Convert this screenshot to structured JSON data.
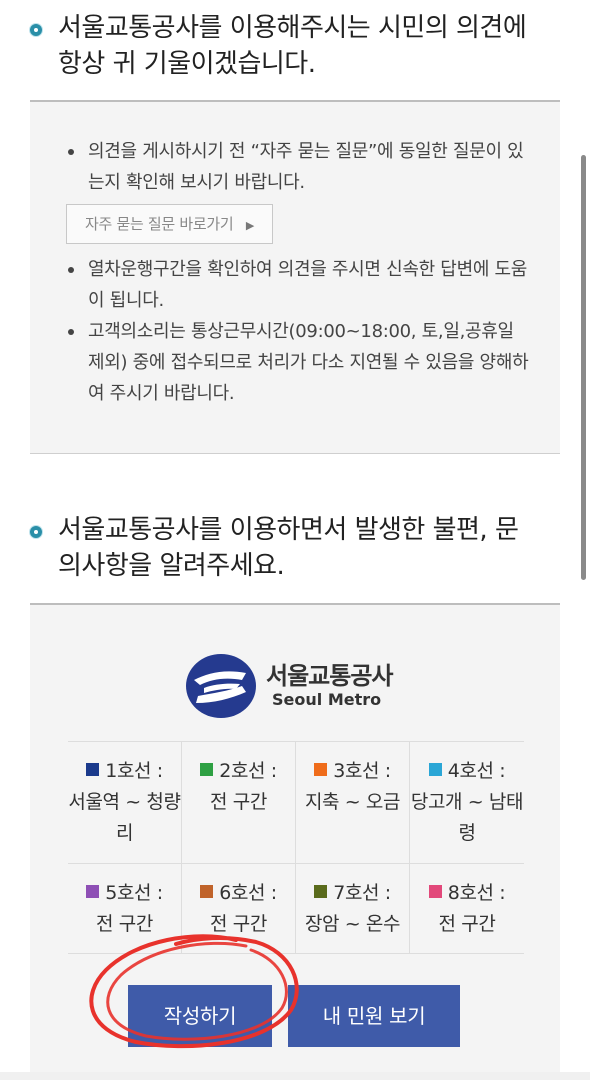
{
  "section1": {
    "title_line1": "서울교통공사를 이용해주시는 시민의 의견에",
    "title_line2": "항상 귀 기울이겠습니다."
  },
  "notices": {
    "item1": "의견을 게시하시기 전 “자주 묻는 질문”에 동일한 질문이 있는지 확인해 보시기 바랍니다.",
    "faq_button": "자주 묻는 질문 바로가기",
    "faq_arrow": "▶",
    "item2": "열차운행구간을 확인하여 의견을 주시면 신속한 답변에 도움이 됩니다.",
    "item3": "고객의소리는 통상근무시간(09:00~18:00, 토,일,공휴일 제외) 중에 접수되므로 처리가 다소 지연될 수 있음을 양해하여 주시기 바랍니다."
  },
  "section2": {
    "title_line1": "서울교통공사를 이용하면서 발생한 불편, 문",
    "title_line2": "의사항을 알려주세요."
  },
  "logo": {
    "name_ko": "서울교통공사",
    "name_en": "Seoul Metro"
  },
  "lines": [
    {
      "label": "1호선 :",
      "route": "서울역 ~ 청량리",
      "color": "#1b3a8c"
    },
    {
      "label": "2호선 :",
      "route": "전 구간",
      "color": "#2ea043"
    },
    {
      "label": "3호선 :",
      "route": "지축 ~ 오금",
      "color": "#ef6c1a"
    },
    {
      "label": "4호선 :",
      "route": "당고개 ~ 남태령",
      "color": "#2aa6d6"
    },
    {
      "label": "5호선 :",
      "route": "전 구간",
      "color": "#8e4fb5"
    },
    {
      "label": "6호선 :",
      "route": "전 구간",
      "color": "#c0632a"
    },
    {
      "label": "7호선 :",
      "route": "장암 ~ 온수",
      "color": "#5a6b1c"
    },
    {
      "label": "8호선 :",
      "route": "전 구간",
      "color": "#e2487a"
    }
  ],
  "buttons": {
    "write": "작성하기",
    "my_complaints": "내 민원 보기"
  },
  "colors": {
    "accent": "#2a8fa8",
    "button": "#3f5ba9",
    "annotation": "#e8322c"
  }
}
